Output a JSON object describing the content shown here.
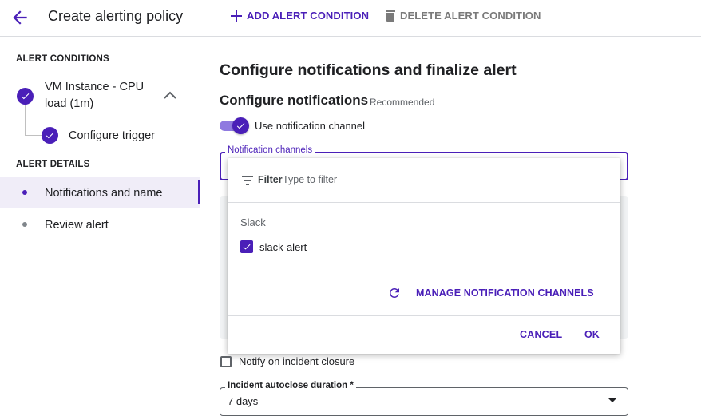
{
  "header": {
    "title": "Create alerting policy",
    "add_condition": "ADD ALERT CONDITION",
    "delete_condition": "DELETE ALERT CONDITION"
  },
  "sidebar": {
    "conditions_label": "ALERT CONDITIONS",
    "condition_name_line1": "VM Instance - CPU",
    "condition_name_line2": "load (1m)",
    "trigger": "Configure trigger",
    "details_label": "ALERT DETAILS",
    "nav_notifications": "Notifications and name",
    "nav_review": "Review alert"
  },
  "main": {
    "title": "Configure notifications and finalize alert",
    "subtitle": "Configure notifications",
    "recommended": "Recommended",
    "toggle_label": "Use notification channel",
    "channels_label": "Notification channels",
    "notify_closure": "Notify on incident closure",
    "autoclose_label": "Incident autoclose duration *",
    "autoclose_value": "7 days"
  },
  "dropdown": {
    "filter_label": "Filter",
    "filter_placeholder": "Type to filter",
    "group": "Slack",
    "option": "slack-alert",
    "manage": "MANAGE NOTIFICATION CHANNELS",
    "cancel": "CANCEL",
    "ok": "OK"
  },
  "theme": {
    "accent": "#4a1fb8",
    "text": "#202124",
    "muted": "#5f6368",
    "active_bg": "#f0edf8"
  },
  "icons": [
    "back-arrow-icon",
    "plus-icon",
    "trash-icon",
    "check-icon",
    "chevron-up-icon",
    "filter-icon",
    "refresh-icon",
    "dropdown-arrow-icon"
  ]
}
